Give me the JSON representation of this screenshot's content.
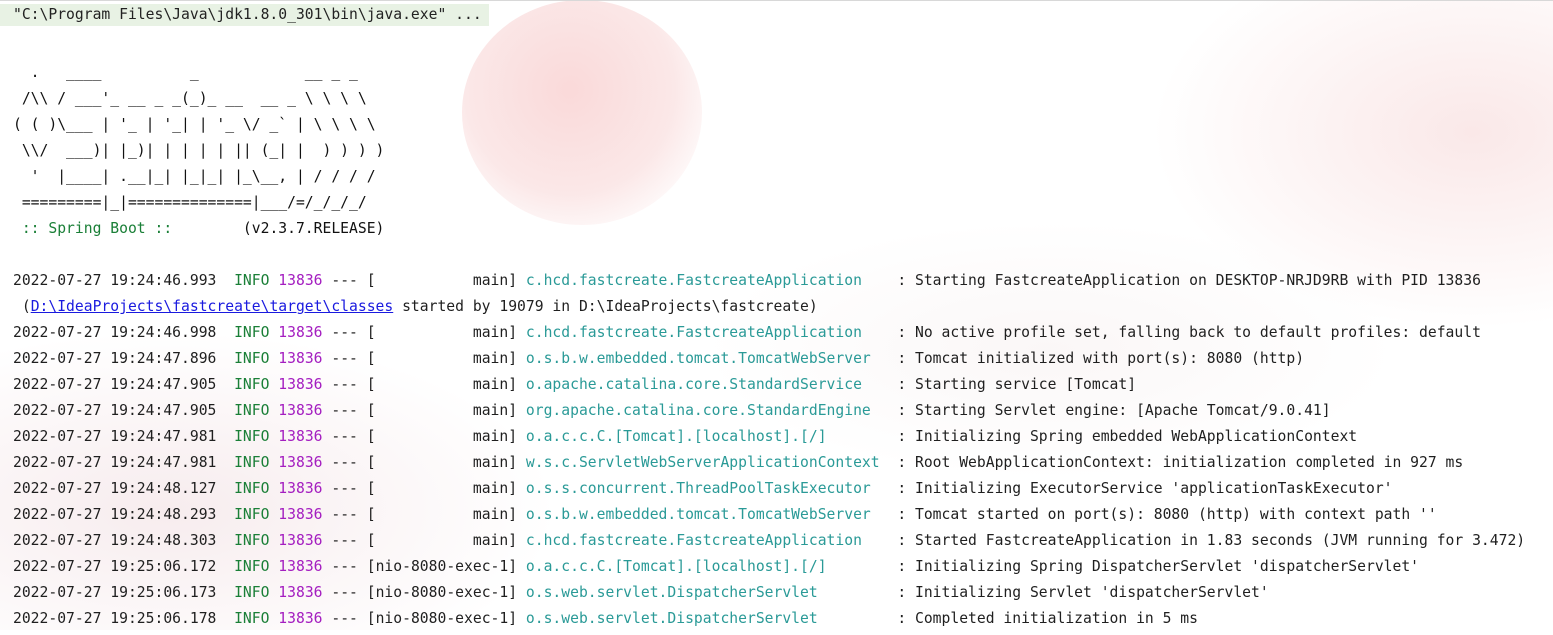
{
  "command_line": "\"C:\\Program Files\\Java\\jdk1.8.0_301\\bin\\java.exe\" ...",
  "banner_lines": [
    "  .   ____          _            __ _ _",
    " /\\\\ / ___'_ __ _ _(_)_ __  __ _ \\ \\ \\ \\",
    "( ( )\\___ | '_ | '_| | '_ \\/ _` | \\ \\ \\ \\",
    " \\\\/  ___)| |_)| | | | | || (_| |  ) ) ) )",
    "  '  |____| .__|_| |_|_| |_\\__, | / / / /",
    " =========|_|==============|___/=/_/_/_/"
  ],
  "spring_boot_label": " :: Spring Boot :: ",
  "spring_boot_version": "       (v2.3.7.RELEASE)",
  "log_lines": [
    {
      "ts": "2022-07-27 19:24:46.993",
      "level": "INFO",
      "pid": "13836",
      "sep": " --- ",
      "thread": "[           main]",
      "logger": "c.hcd.fastcreate.FastcreateApplication   ",
      "msg": ": Starting FastcreateApplication on DESKTOP-NRJD9RB with PID 13836"
    },
    {
      "cont_prefix": " (",
      "cont_link": "D:\\IdeaProjects\\fastcreate\\target\\classes",
      "cont_suffix": " started by 19079 in D:\\IdeaProjects\\fastcreate)"
    },
    {
      "ts": "2022-07-27 19:24:46.998",
      "level": "INFO",
      "pid": "13836",
      "sep": " --- ",
      "thread": "[           main]",
      "logger": "c.hcd.fastcreate.FastcreateApplication   ",
      "msg": ": No active profile set, falling back to default profiles: default"
    },
    {
      "ts": "2022-07-27 19:24:47.896",
      "level": "INFO",
      "pid": "13836",
      "sep": " --- ",
      "thread": "[           main]",
      "logger": "o.s.b.w.embedded.tomcat.TomcatWebServer  ",
      "msg": ": Tomcat initialized with port(s): 8080 (http)"
    },
    {
      "ts": "2022-07-27 19:24:47.905",
      "level": "INFO",
      "pid": "13836",
      "sep": " --- ",
      "thread": "[           main]",
      "logger": "o.apache.catalina.core.StandardService   ",
      "msg": ": Starting service [Tomcat]"
    },
    {
      "ts": "2022-07-27 19:24:47.905",
      "level": "INFO",
      "pid": "13836",
      "sep": " --- ",
      "thread": "[           main]",
      "logger": "org.apache.catalina.core.StandardEngine  ",
      "msg": ": Starting Servlet engine: [Apache Tomcat/9.0.41]"
    },
    {
      "ts": "2022-07-27 19:24:47.981",
      "level": "INFO",
      "pid": "13836",
      "sep": " --- ",
      "thread": "[           main]",
      "logger": "o.a.c.c.C.[Tomcat].[localhost].[/]       ",
      "msg": ": Initializing Spring embedded WebApplicationContext"
    },
    {
      "ts": "2022-07-27 19:24:47.981",
      "level": "INFO",
      "pid": "13836",
      "sep": " --- ",
      "thread": "[           main]",
      "logger": "w.s.c.ServletWebServerApplicationContext ",
      "msg": ": Root WebApplicationContext: initialization completed in 927 ms"
    },
    {
      "ts": "2022-07-27 19:24:48.127",
      "level": "INFO",
      "pid": "13836",
      "sep": " --- ",
      "thread": "[           main]",
      "logger": "o.s.s.concurrent.ThreadPoolTaskExecutor  ",
      "msg": ": Initializing ExecutorService 'applicationTaskExecutor'"
    },
    {
      "ts": "2022-07-27 19:24:48.293",
      "level": "INFO",
      "pid": "13836",
      "sep": " --- ",
      "thread": "[           main]",
      "logger": "o.s.b.w.embedded.tomcat.TomcatWebServer  ",
      "msg": ": Tomcat started on port(s): 8080 (http) with context path ''"
    },
    {
      "ts": "2022-07-27 19:24:48.303",
      "level": "INFO",
      "pid": "13836",
      "sep": " --- ",
      "thread": "[           main]",
      "logger": "c.hcd.fastcreate.FastcreateApplication   ",
      "msg": ": Started FastcreateApplication in 1.83 seconds (JVM running for 3.472)"
    },
    {
      "ts": "2022-07-27 19:25:06.172",
      "level": "INFO",
      "pid": "13836",
      "sep": " --- ",
      "thread": "[nio-8080-exec-1]",
      "logger": "o.a.c.c.C.[Tomcat].[localhost].[/]       ",
      "msg": ": Initializing Spring DispatcherServlet 'dispatcherServlet'"
    },
    {
      "ts": "2022-07-27 19:25:06.173",
      "level": "INFO",
      "pid": "13836",
      "sep": " --- ",
      "thread": "[nio-8080-exec-1]",
      "logger": "o.s.web.servlet.DispatcherServlet        ",
      "msg": ": Initializing Servlet 'dispatcherServlet'"
    },
    {
      "ts": "2022-07-27 19:25:06.178",
      "level": "INFO",
      "pid": "13836",
      "sep": " --- ",
      "thread": "[nio-8080-exec-1]",
      "logger": "o.s.web.servlet.DispatcherServlet        ",
      "msg": ": Completed initialization in 5 ms"
    }
  ],
  "colors": {
    "level_info": "#1a7f37",
    "pid": "#a41ec0",
    "logger": "#2a9a97",
    "link": "#1a1adf",
    "command_bg": "#e8f2e4"
  }
}
